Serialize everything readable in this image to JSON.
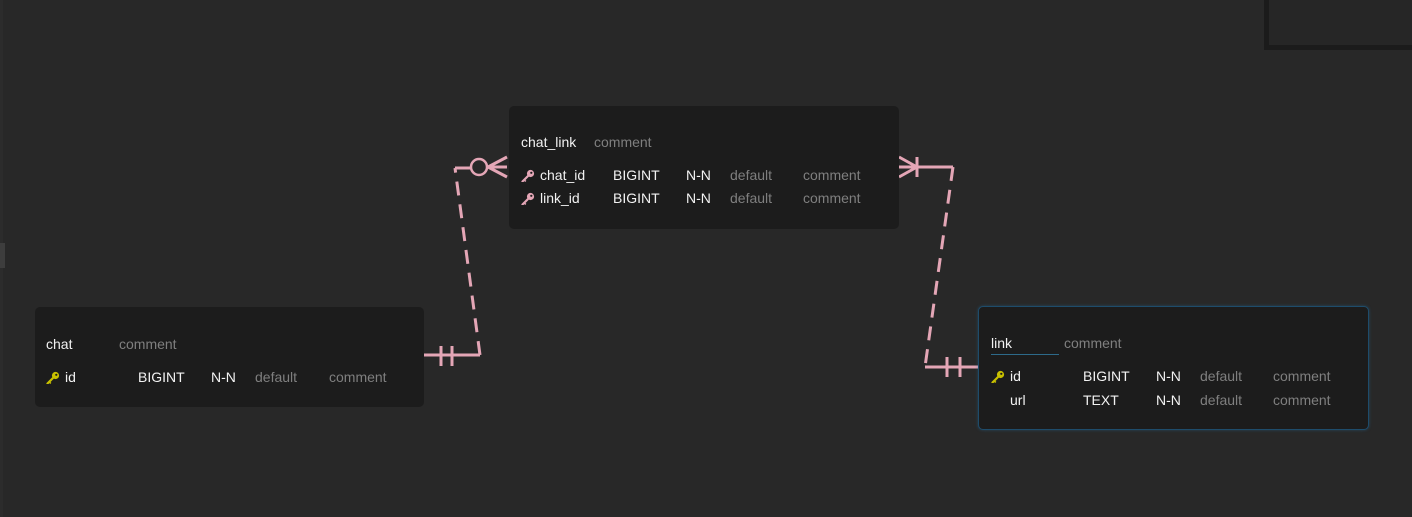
{
  "colors": {
    "canvas": "#282828",
    "table_bg": "#1c1c1c",
    "relation_line": "#e4a6b6",
    "primary_key": "#c8c000",
    "foreign_key": "#e4a6b6",
    "selected_border": "#1e4c6b"
  },
  "tables": {
    "chat": {
      "name": "chat",
      "comment": "comment",
      "columns": [
        {
          "key": "primary-key-icon",
          "name": "id",
          "type": "BIGINT",
          "nullable": "N-N",
          "default": "default",
          "comment": "comment"
        }
      ]
    },
    "chat_link": {
      "name": "chat_link",
      "comment": "comment",
      "columns": [
        {
          "key": "foreign-key-icon",
          "name": "chat_id",
          "type": "BIGINT",
          "nullable": "N-N",
          "default": "default",
          "comment": "comment"
        },
        {
          "key": "foreign-key-icon",
          "name": "link_id",
          "type": "BIGINT",
          "nullable": "N-N",
          "default": "default",
          "comment": "comment"
        }
      ]
    },
    "link": {
      "name": "link",
      "comment": "comment",
      "selected": true,
      "columns": [
        {
          "key": "primary-key-icon",
          "name": "id",
          "type": "BIGINT",
          "nullable": "N-N",
          "default": "default",
          "comment": "comment"
        },
        {
          "key": "",
          "name": "url",
          "type": "TEXT",
          "nullable": "N-N",
          "default": "default",
          "comment": "comment"
        }
      ]
    }
  },
  "relations": [
    {
      "from": "chat",
      "to": "chat_link",
      "from_cardinality": "exactly-one",
      "to_cardinality": "zero-or-many"
    },
    {
      "from": "link",
      "to": "chat_link",
      "from_cardinality": "exactly-one",
      "to_cardinality": "one-or-many"
    }
  ]
}
